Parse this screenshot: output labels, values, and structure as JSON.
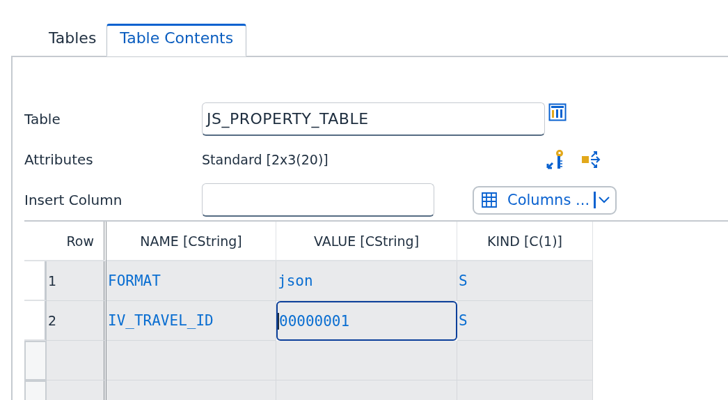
{
  "tabs": [
    {
      "label": "Tables",
      "selected": false
    },
    {
      "label": "Table Contents",
      "selected": true
    }
  ],
  "form": {
    "table": {
      "label": "Table",
      "value": "JS_PROPERTY_TABLE"
    },
    "attributes": {
      "label": "Attributes",
      "value": "Standard [2x3(20)]"
    },
    "insert_column": {
      "label": "Insert Column"
    },
    "columns_button": {
      "label": "Columns ..."
    }
  },
  "table": {
    "columns": [
      "Row",
      "NAME [CString]",
      "VALUE [CString]",
      "KIND [C(1)]"
    ],
    "rows": [
      {
        "row": "1",
        "cells": [
          {
            "text": "FORMAT",
            "focused": false
          },
          {
            "text": "json",
            "focused": false
          },
          {
            "text": "S",
            "focused": false
          }
        ]
      },
      {
        "row": "2",
        "cells": [
          {
            "text": "IV_TRAVEL_ID",
            "focused": false
          },
          {
            "text": "00000001",
            "focused": true
          },
          {
            "text": "S",
            "focused": false
          }
        ]
      }
    ]
  }
}
